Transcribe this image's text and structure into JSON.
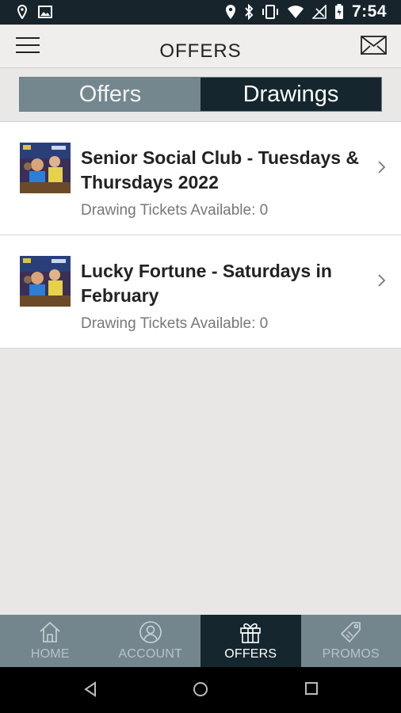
{
  "status": {
    "time": "7:54",
    "left_icons": [
      "location-pin-icon",
      "image-icon"
    ],
    "right_icons": [
      "location-icon",
      "bluetooth-icon",
      "vibrate-icon",
      "wifi-icon",
      "no-signal-icon",
      "battery-icon"
    ]
  },
  "header": {
    "title": "OFFERS",
    "menu_icon": "hamburger-menu-icon",
    "mail_icon": "envelope-icon"
  },
  "segments": {
    "options": [
      "Offers",
      "Drawings"
    ],
    "selected": "Drawings"
  },
  "drawings": [
    {
      "title": "Senior Social Club - Tuesdays & Thursdays 2022",
      "subtitle": "Drawing Tickets Available: 0"
    },
    {
      "title": "Lucky Fortune - Saturdays in February",
      "subtitle": "Drawing Tickets Available: 0"
    }
  ],
  "tabbar": {
    "items": [
      {
        "label": "HOME",
        "icon": "home-icon"
      },
      {
        "label": "ACCOUNT",
        "icon": "account-icon"
      },
      {
        "label": "OFFERS",
        "icon": "gift-icon"
      },
      {
        "label": "PROMOS",
        "icon": "tag-icon"
      }
    ],
    "active": "OFFERS"
  },
  "colors": {
    "status_bar": "#17242b",
    "accent_dark": "#15262e",
    "accent_muted": "#74878f",
    "background": "#e8e7e5"
  }
}
